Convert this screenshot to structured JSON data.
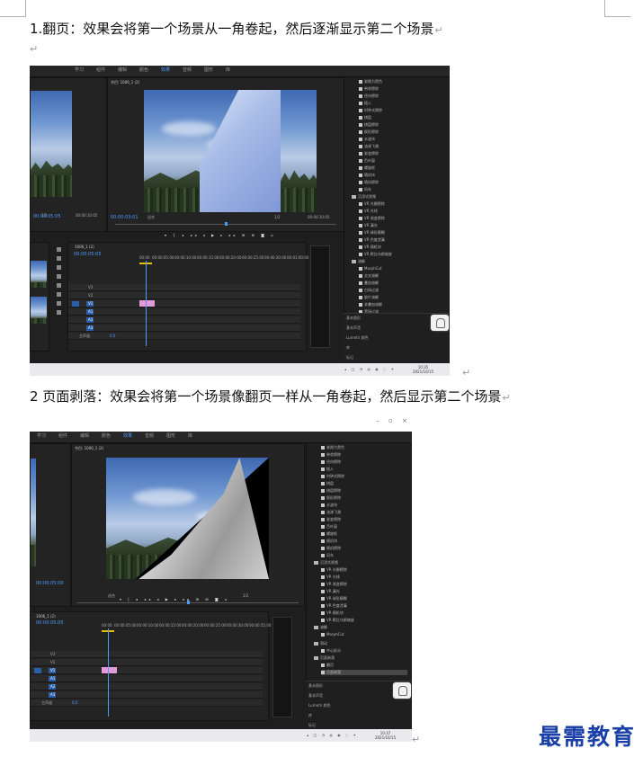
{
  "paragraphs": [
    {
      "text": "1.翻页：效果会将第一个场景从一角卷起，然后逐渐显示第二个场景",
      "mark": "↵"
    },
    {
      "text": "2 页面剥落：效果会将第一个场景像翻页一样从一角卷起，然后显示第二个场景",
      "mark": "↵"
    }
  ],
  "return_mark": "↵",
  "screenshot1": {
    "menu": [
      "学习",
      "组件",
      "编辑",
      "颜色",
      "效果",
      "音频",
      "图形",
      "库"
    ],
    "active_menu": "效果",
    "program_title": "节目: 1006_1 (2)",
    "timecode_left": "00:00:05:05",
    "timecode_current": "00:00:03:01",
    "fit_label": "适合",
    "page_fraction": "1/2",
    "timecode_end": "00:00:10:05",
    "sequence_tab": "1006_1 (2)",
    "timeline_tc": "00:00:05:05",
    "ruler": [
      "00:00",
      "00:00:05:00",
      "00:00:10:00",
      "00:00:15:00",
      "00:00:20:00",
      "00:00:25:00",
      "00:00:30:00",
      "00:00:35:00",
      "00:00:40:00",
      "00:00:45:00",
      "00:01:00:00"
    ],
    "tracks_video": [
      "V3",
      "V2",
      "V1"
    ],
    "tracks_audio": [
      "A1",
      "A2",
      "A3"
    ],
    "master_label": "主声道",
    "master_value": "0.0",
    "effects_list": [
      "渐隐为黑色",
      "带状擦除",
      "径向擦除",
      "插入",
      "时钟式擦除",
      "棋盘",
      "棋盘擦除",
      "楔形擦除",
      "水波块",
      "油漆飞溅",
      "渐变擦除",
      "百叶窗",
      "螺旋框",
      "随机块",
      "随机擦除",
      "风车"
    ],
    "folder_immersive": "沉浸式视频",
    "immersive_list": [
      "VR 光圈擦除",
      "VR 光线",
      "VR 渐变擦除",
      "VR 漏光",
      "VR 球形模糊",
      "VR 色度泄漏",
      "VR 随机块",
      "VR 默比乌斯缩放"
    ],
    "folder_dissolve": "溶解",
    "dissolve_list": [
      "MorphCut",
      "交叉溶解",
      "叠加溶解",
      "白场过渡",
      "胶片溶解",
      "非叠加溶解",
      "黑场过渡"
    ],
    "folder_slide": "滑动",
    "slide_list": [
      "中心拆分"
    ],
    "folder_page": "页面剥落",
    "page_list": [
      "翻页",
      "页面剥落"
    ],
    "selected_effect": "翻页",
    "side_panels": [
      "基本图形",
      "基本声音",
      "Lumetri 颜色",
      "库",
      "标记"
    ],
    "clock_time": "10:35",
    "clock_date": "2021/10/15"
  },
  "screenshot2": {
    "window_controls": [
      "–",
      "▫",
      "×"
    ],
    "menu": [
      "学习",
      "组件",
      "编辑",
      "颜色",
      "效果",
      "音频",
      "图形",
      "库"
    ],
    "active_menu": "效果",
    "program_title": "节目: 1006_1 (2)",
    "timecode_left": "00:00:05:00",
    "fit_label": "适合",
    "page_fraction": "1/2",
    "sequence_tab": "1006_1 (2)",
    "timeline_tc": "00:00:05:05",
    "ruler": [
      "00:00",
      "00:00:05:00",
      "00:00:10:00",
      "00:00:15:00",
      "00:00:20:00",
      "00:00:25:00",
      "00:00:30:00",
      "00:00:35:00"
    ],
    "tracks_video": [
      "V3",
      "V2",
      "V1"
    ],
    "tracks_audio": [
      "A1",
      "A2",
      "A3"
    ],
    "master_label": "主声道",
    "master_value": "0.0",
    "effects_list": [
      "渐隐为黑色",
      "带状擦除",
      "径向擦除",
      "插入",
      "时钟式擦除",
      "棋盘",
      "棋盘擦除",
      "楔形擦除",
      "水波块",
      "油漆飞溅",
      "渐变擦除",
      "百叶窗",
      "螺旋框",
      "随机块",
      "随机擦除",
      "风车"
    ],
    "folder_immersive": "沉浸式视频",
    "immersive_list": [
      "VR 光圈擦除",
      "VR 光线",
      "VR 渐变擦除",
      "VR 漏光",
      "VR 球形模糊",
      "VR 色度泄漏",
      "VR 随机块",
      "VR 默比乌斯缩放"
    ],
    "folder_dissolve": "溶解",
    "dissolve_list": [
      "MorphCut",
      "交叉溶解",
      "叠加溶解",
      "白场过渡",
      "胶片溶解",
      "非叠加溶解",
      "黑场过渡"
    ],
    "folder_slide": "滑动",
    "slide_list": [
      "中心拆分"
    ],
    "folder_page": "页面剥落",
    "page_list": [
      "翻页",
      "页面剥落"
    ],
    "selected_effect": "页面剥落",
    "side_panels": [
      "基本图形",
      "基本声音",
      "Lumetri 颜色",
      "库",
      "标记"
    ],
    "clock_time": "10:37",
    "clock_date": "2021/10/15"
  },
  "watermark": "最需教育"
}
